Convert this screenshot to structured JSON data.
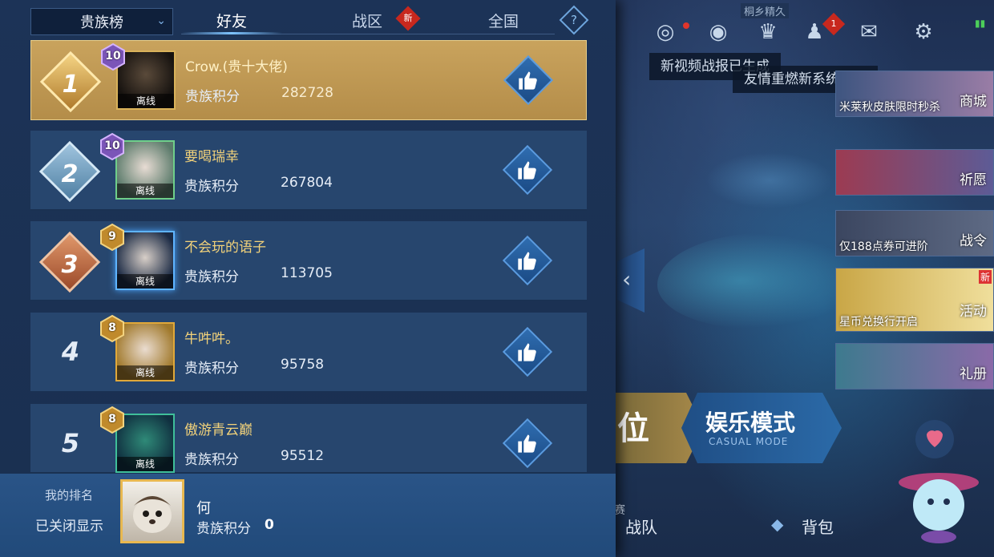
{
  "leaderboard": {
    "dropdown_label": "贵族榜",
    "tabs": [
      {
        "label": "好友",
        "active": true
      },
      {
        "label": "战区",
        "badge": "新"
      },
      {
        "label": "全国"
      }
    ],
    "help_icon": "?",
    "score_label": "贵族积分",
    "offline_label": "离线",
    "entries": [
      {
        "rank": "1",
        "level": "10",
        "name": "Crow.(贵十大佬)",
        "score": "282728"
      },
      {
        "rank": "2",
        "level": "10",
        "name": "要喝瑞幸",
        "score": "267804"
      },
      {
        "rank": "3",
        "level": "9",
        "name": "不会玩的语子",
        "score": "113705"
      },
      {
        "rank": "4",
        "level": "8",
        "name": "牛吽吽。",
        "score": "95758"
      },
      {
        "rank": "5",
        "level": "8",
        "name": "傲游青云巅",
        "score": "95512"
      }
    ],
    "my_rank": {
      "label": "我的排名",
      "status": "已关闭显示",
      "name": "何",
      "score_label": "贵族积分",
      "score": "0"
    }
  },
  "lobby": {
    "home_tag": "桐乡精久",
    "notify_count": "1",
    "tooltips": [
      "新视频战报已生成",
      "友情重燃新系统上线"
    ],
    "side_cards": [
      {
        "caption": "米莱秋皮肤限时秒杀",
        "label": "商城"
      },
      {
        "caption": "",
        "label": "祈愿"
      },
      {
        "caption": "仅188点券可进阶",
        "label": "战令"
      },
      {
        "caption": "星币兑换行开启",
        "label": "活动",
        "badge": "新"
      },
      {
        "caption": "",
        "label": "礼册"
      }
    ],
    "mode_ranked_char": "位",
    "mode_casual": {
      "title": "娱乐模式",
      "subtitle": "CASUAL MODE"
    },
    "bottom": {
      "team": "战队",
      "bag": "背包",
      "partial": "赛"
    }
  },
  "colors": {
    "gold_row": "#c9a35d",
    "row": "#27466e",
    "panel": "#1c3357",
    "accent": "#7ec4ff"
  }
}
